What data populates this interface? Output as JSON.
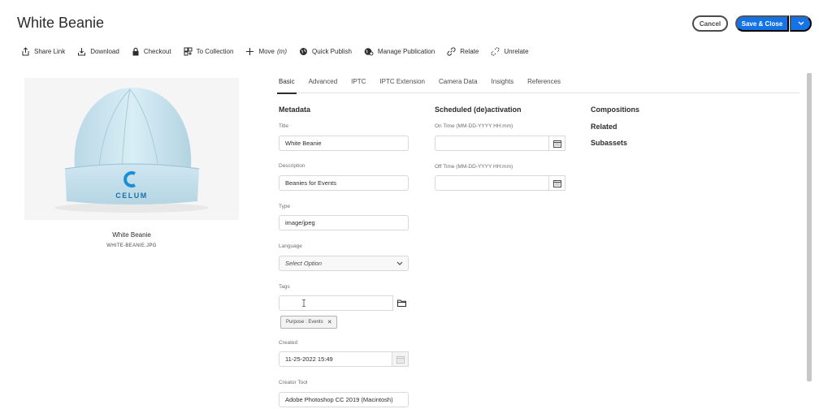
{
  "header": {
    "title": "White Beanie",
    "cancel_label": "Cancel",
    "save_label": "Save & Close"
  },
  "toolbar": {
    "items": [
      {
        "label": "Share Link",
        "icon": "share-icon"
      },
      {
        "label": "Download",
        "icon": "download-icon"
      },
      {
        "label": "Checkout",
        "icon": "lock-icon"
      },
      {
        "label": "To Collection",
        "icon": "collection-icon"
      },
      {
        "label": "Move",
        "extra": "(m)",
        "icon": "move-icon"
      },
      {
        "label": "Quick Publish",
        "icon": "globe-icon"
      },
      {
        "label": "Manage Publication",
        "icon": "globe-manage-icon"
      },
      {
        "label": "Relate",
        "icon": "link-icon"
      },
      {
        "label": "Unrelate",
        "icon": "unlink-icon"
      }
    ]
  },
  "asset": {
    "name": "White Beanie",
    "filename": "WHITE-BEANIE.JPG",
    "logo_text": "CELUM"
  },
  "tabs": [
    "Basic",
    "Advanced",
    "IPTC",
    "IPTC Extension",
    "Camera Data",
    "Insights",
    "References"
  ],
  "metadata": {
    "heading": "Metadata",
    "title_label": "Title",
    "title_value": "White Beanie",
    "description_label": "Description",
    "description_value": "Beanies for Events",
    "type_label": "Type",
    "type_value": "image/jpeg",
    "language_label": "Language",
    "language_value": "Select Option",
    "tags_label": "Tags",
    "tags_value": "",
    "tag_chip": "Purpose : Events",
    "created_label": "Created",
    "created_value": "11-25-2022 15:49",
    "creator_tool_label": "Creator Tool",
    "creator_tool_value": "Adobe Photoshop CC 2019 (Macintosh)"
  },
  "activation": {
    "heading": "Scheduled (de)activation",
    "on_label": "On Time (MM-DD-YYYY HH:mm)",
    "on_value": "",
    "off_label": "Off Time (MM-DD-YYYY HH:mm)",
    "off_value": ""
  },
  "related": {
    "compositions": "Compositions",
    "related": "Related",
    "subassets": "Subassets"
  },
  "colors": {
    "accent": "#1473e6",
    "logo": "#1b8fd6"
  }
}
